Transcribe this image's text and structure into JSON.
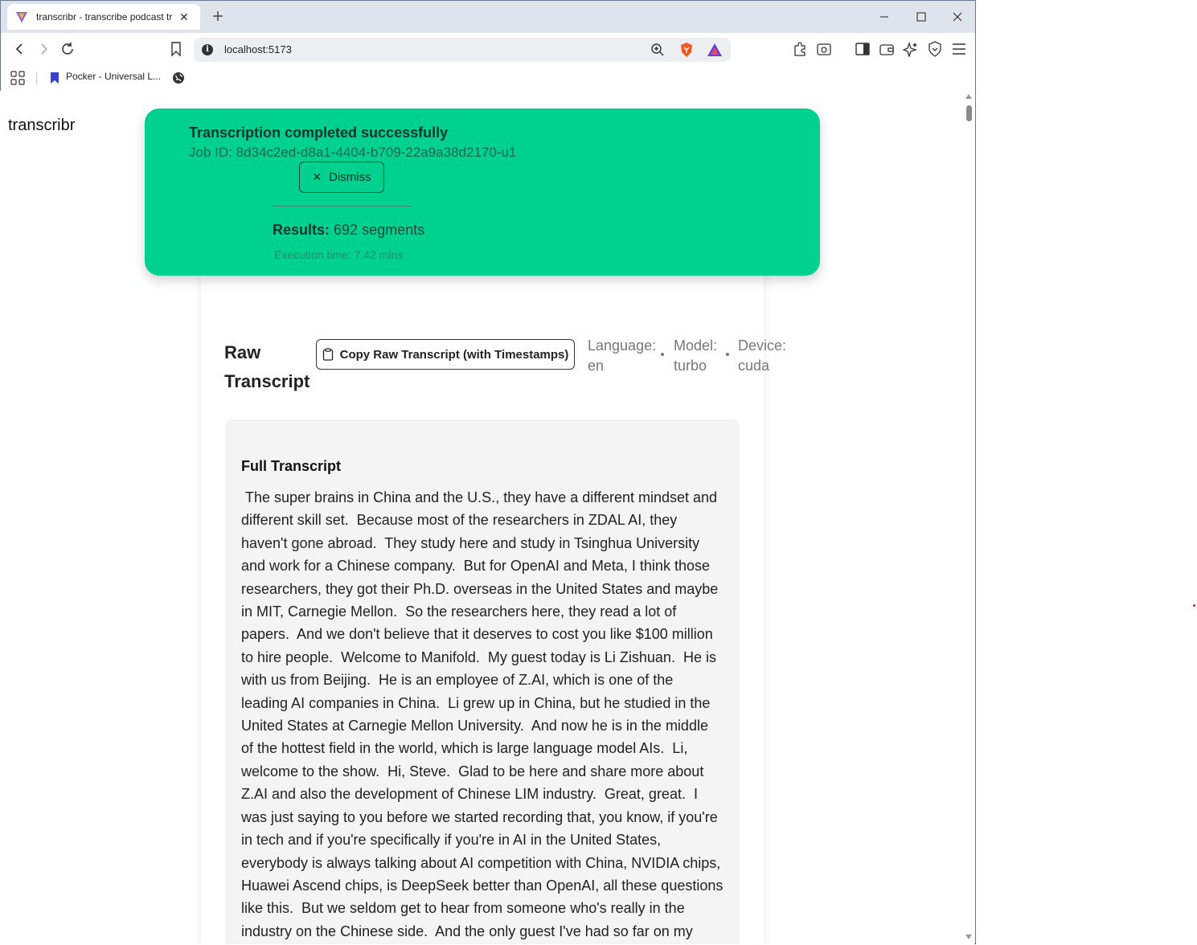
{
  "browser": {
    "tab_title": "transcribr - transcribe podcast tr",
    "url": "localhost:5173",
    "bookmark_label": "Pocker - Universal L..."
  },
  "app": {
    "brand": "transcribr"
  },
  "toast": {
    "title": "Transcription completed successfully",
    "job_id": "Job ID: 8d34c2ed-d8a1-4404-b709-22a9a38d2170-u1",
    "dismiss_label": "Dismiss",
    "results_label": "Results:",
    "results_value": "692 segments",
    "execution_time": "Execution time: 7.42 mins"
  },
  "raw": {
    "title": "Raw Transcript",
    "copy_label": "Copy Raw Transcript (with Timestamps)",
    "language_label": "Language:",
    "language_value": "en",
    "model_label": "Model:",
    "model_value": "turbo",
    "device_label": "Device:",
    "device_value": "cuda"
  },
  "transcript": {
    "heading": "Full Transcript",
    "text": " The super brains in China and the U.S., they have a different mindset and different skill set.  Because most of the researchers in ZDAL AI, they haven't gone abroad.  They study here and study in Tsinghua University and work for a Chinese company.  But for OpenAI and Meta, I think those researchers, they got their Ph.D. overseas in the United States and maybe in MIT, Carnegie Mellon.  So the researchers here, they read a lot of papers.  And we don't believe that it deserves to cost you like $100 million to hire people.  Welcome to Manifold.  My guest today is Li Zishuan.  He is with us from Beijing.  He is an employee of Z.AI, which is one of the leading AI companies in China.  Li grew up in China, but he studied in the United States at Carnegie Mellon University.  And now he is in the middle of the hottest field in the world, which is large language model AIs.  Li, welcome to the show.  Hi, Steve.  Glad to be here and share more about Z.AI and also the development of Chinese LIM industry.  Great, great.  I was just saying to you before we started recording that, you know, if you're in tech and if you're specifically if you're in AI in the United States,  everybody is always talking about AI competition with China, NVIDIA chips, Huawei Ascend chips, is DeepSeek better than OpenAI, all these questions like this.  But we seldom get to hear from someone who's really in the industry on the Chinese side.  And the only guest I've had so far on my show that has that background is someone who was a"
  },
  "colors": {
    "toast_bg": "#00d18f",
    "page_bg": "#ffffff",
    "transcript_bg": "#f4f4f5"
  },
  "icons": [
    "brave-favicon",
    "close-icon",
    "plus-icon",
    "minimize-icon",
    "maximize-icon",
    "back-icon",
    "forward-icon",
    "reload-icon",
    "bookmark-icon",
    "info-icon",
    "zoom-icon",
    "brave-shield-icon",
    "brave-rewards-icon",
    "extensions-icon",
    "sidebar-icon",
    "wallet-icon",
    "leo-icon",
    "vpn-icon",
    "menu-icon",
    "apps-grid-icon",
    "globe-icon",
    "clipboard-icon"
  ]
}
